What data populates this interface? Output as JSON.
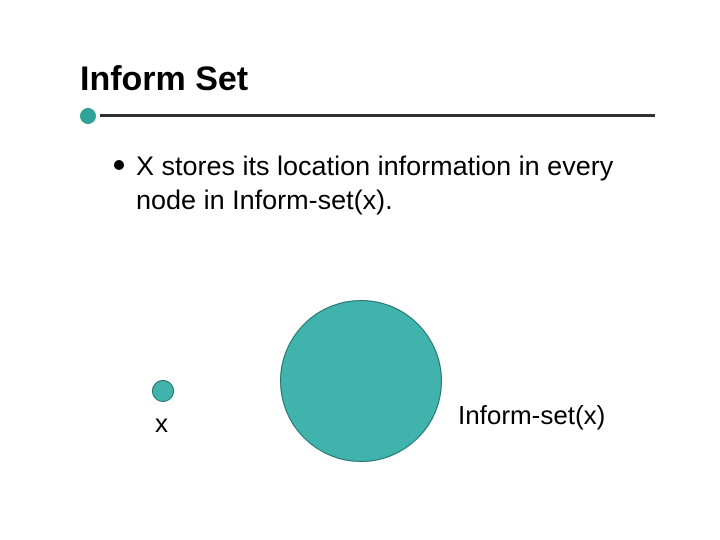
{
  "title": "Inform Set",
  "bullet": "X stores its location information in every node in Inform-set(x).",
  "labels": {
    "x": "x",
    "set": "Inform-set(x)"
  },
  "colors": {
    "teal": "#3fb3ac",
    "tealBorder": "#1f6f69",
    "underlineDot": "#2fa39a",
    "underline": "#2f2f2f"
  }
}
